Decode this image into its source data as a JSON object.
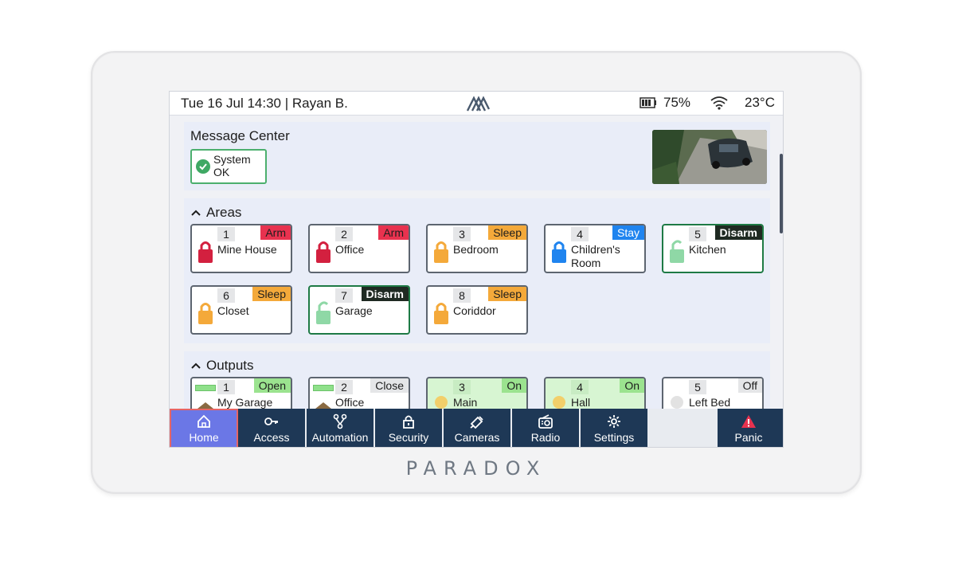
{
  "status_bar": {
    "datetime_user": "Tue 16 Jul 14:30 | Rayan B.",
    "battery": "75%",
    "temperature": "23°C"
  },
  "message_center": {
    "title": "Message Center",
    "status": "System OK"
  },
  "areas": {
    "title": "Areas",
    "items": [
      {
        "num": "1",
        "name": "Mine House",
        "state": "Arm"
      },
      {
        "num": "2",
        "name": "Office",
        "state": "Arm"
      },
      {
        "num": "3",
        "name": "Bedroom",
        "state": "Sleep"
      },
      {
        "num": "4",
        "name": "Children's Room",
        "state": "Stay"
      },
      {
        "num": "5",
        "name": "Kitchen",
        "state": "Disarm"
      },
      {
        "num": "6",
        "name": "Closet",
        "state": "Sleep"
      },
      {
        "num": "7",
        "name": "Garage",
        "state": "Disarm"
      },
      {
        "num": "8",
        "name": "Coriddor",
        "state": "Sleep"
      }
    ]
  },
  "outputs": {
    "title": "Outputs",
    "items": [
      {
        "num": "1",
        "name": "My Garage",
        "state": "Open"
      },
      {
        "num": "2",
        "name": "Office",
        "state": "Close"
      },
      {
        "num": "3",
        "name": "Main",
        "state": "On"
      },
      {
        "num": "4",
        "name": "Hall",
        "state": "On"
      },
      {
        "num": "5",
        "name": "Left Bed",
        "state": "Off"
      }
    ]
  },
  "nav": {
    "home": "Home",
    "access": "Access",
    "automation": "Automation",
    "security": "Security",
    "cameras": "Cameras",
    "radio": "Radio",
    "settings": "Settings",
    "panic": "Panic"
  },
  "brand": "PARADOX",
  "colors": {
    "arm": "#e8324f",
    "sleep": "#f4a93a",
    "stay": "#1f84ef",
    "disarm": "#1f2a22",
    "on": "#9be38f",
    "nav_bg": "#1e3856",
    "nav_active": "#6b77e6"
  }
}
